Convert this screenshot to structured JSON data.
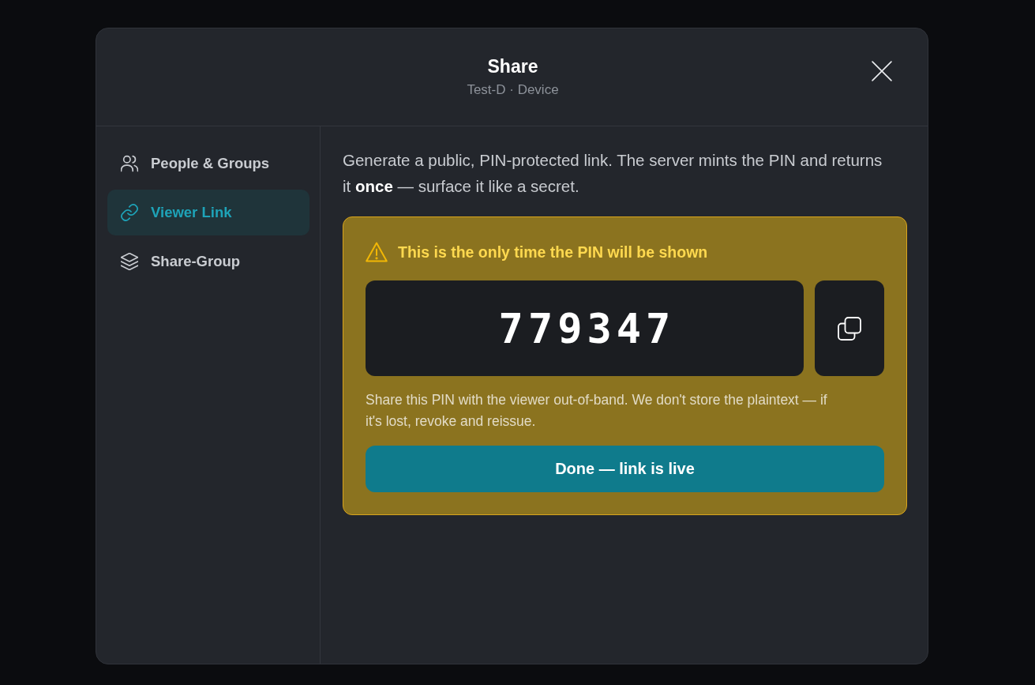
{
  "dialog": {
    "title": "Share",
    "subtitle": "Test-D · Device"
  },
  "sidebar": {
    "items": [
      {
        "label": "People & Groups",
        "kind": "people",
        "selected": false
      },
      {
        "label": "Viewer Link",
        "kind": "link",
        "selected": true
      },
      {
        "label": "Share-Group",
        "kind": "layers",
        "selected": false
      }
    ]
  },
  "viewer_link": {
    "description": "Generate a public, PIN-protected link. The server mints the PIN and returns it **once** — surface it like a secret.",
    "pin_card": {
      "warning": "This is the only time the PIN will be shown",
      "pin": "779347",
      "note": "Share this PIN with the viewer out-of-band. We don't store the plaintext — if it's lost, revoke and reissue.",
      "done_button": "Done — link is live"
    }
  }
}
